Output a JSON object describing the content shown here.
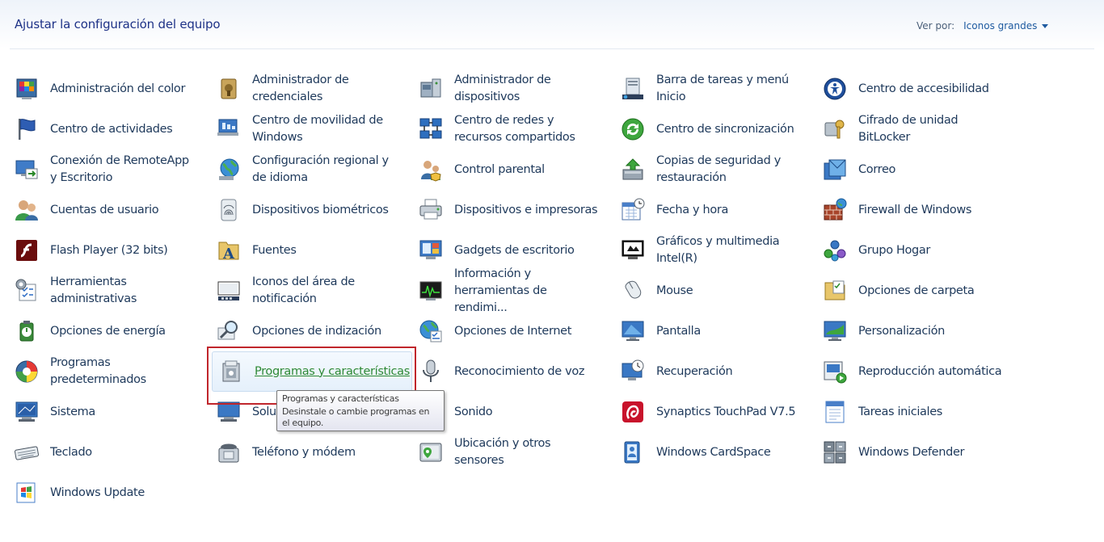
{
  "header": {
    "title": "Ajustar la configuración del equipo",
    "view_by_label": "Ver por:",
    "view_by_value": "Iconos grandes"
  },
  "items": [
    {
      "label": "Administración del color",
      "icon": "color-management-icon"
    },
    {
      "label": "Administrador de credenciales",
      "icon": "credential-manager-icon"
    },
    {
      "label": "Administrador de dispositivos",
      "icon": "device-manager-icon"
    },
    {
      "label": "Barra de tareas y menú Inicio",
      "icon": "taskbar-start-menu-icon"
    },
    {
      "label": "Centro de accesibilidad",
      "icon": "ease-of-access-icon"
    },
    {
      "label": "Centro de actividades",
      "icon": "action-center-flag-icon"
    },
    {
      "label": "Centro de movilidad de Windows",
      "icon": "mobility-center-icon"
    },
    {
      "label": "Centro de redes y recursos compartidos",
      "icon": "network-center-icon"
    },
    {
      "label": "Centro de sincronización",
      "icon": "sync-center-icon"
    },
    {
      "label": "Cifrado de unidad BitLocker",
      "icon": "bitlocker-key-icon"
    },
    {
      "label": "Conexión de RemoteApp y Escritorio",
      "icon": "remoteapp-icon"
    },
    {
      "label": "Configuración regional y de idioma",
      "icon": "region-language-globe-icon"
    },
    {
      "label": "Control parental",
      "icon": "parental-controls-icon"
    },
    {
      "label": "Copias de seguridad y restauración",
      "icon": "backup-restore-icon"
    },
    {
      "label": "Correo",
      "icon": "mail-icon"
    },
    {
      "label": "Cuentas de usuario",
      "icon": "user-accounts-icon"
    },
    {
      "label": "Dispositivos biométricos",
      "icon": "fingerprint-icon"
    },
    {
      "label": "Dispositivos e impresoras",
      "icon": "printer-icon"
    },
    {
      "label": "Fecha y hora",
      "icon": "calendar-clock-icon"
    },
    {
      "label": "Firewall de Windows",
      "icon": "firewall-icon"
    },
    {
      "label": "Flash Player (32 bits)",
      "icon": "flash-player-icon"
    },
    {
      "label": "Fuentes",
      "icon": "fonts-folder-icon"
    },
    {
      "label": "Gadgets de escritorio",
      "icon": "gadgets-icon"
    },
    {
      "label": "Gráficos y multimedia Intel(R)",
      "icon": "intel-graphics-icon"
    },
    {
      "label": "Grupo Hogar",
      "icon": "homegroup-icon"
    },
    {
      "label": "Herramientas administrativas",
      "icon": "admin-tools-icon"
    },
    {
      "label": "Iconos del área de notificación",
      "icon": "notification-area-icon"
    },
    {
      "label": "Información y herramientas de rendimi...",
      "icon": "performance-icon"
    },
    {
      "label": "Mouse",
      "icon": "mouse-icon"
    },
    {
      "label": "Opciones de carpeta",
      "icon": "folder-options-icon"
    },
    {
      "label": "Opciones de energía",
      "icon": "power-options-icon"
    },
    {
      "label": "Opciones de indización",
      "icon": "indexing-magnifier-icon"
    },
    {
      "label": "Opciones de Internet",
      "icon": "internet-options-icon"
    },
    {
      "label": "Pantalla",
      "icon": "display-monitor-icon"
    },
    {
      "label": "Personalización",
      "icon": "personalization-icon"
    },
    {
      "label": "Programas predeterminados",
      "icon": "default-programs-icon"
    },
    {
      "label": "Programas y características",
      "icon": "programs-features-icon"
    },
    {
      "label": "Reconocimiento de voz",
      "icon": "microphone-icon"
    },
    {
      "label": "Recuperación",
      "icon": "recovery-icon"
    },
    {
      "label": "Reproducción automática",
      "icon": "autoplay-icon"
    },
    {
      "label": "Sistema",
      "icon": "system-icon"
    },
    {
      "label": "Solu",
      "icon": "troubleshooting-icon"
    },
    {
      "label": "Sonido",
      "icon": "sound-icon"
    },
    {
      "label": "Synaptics TouchPad V7.5",
      "icon": "synaptics-icon"
    },
    {
      "label": "Tareas iniciales",
      "icon": "getting-started-icon"
    },
    {
      "label": "Teclado",
      "icon": "keyboard-icon"
    },
    {
      "label": "Teléfono y módem",
      "icon": "phone-modem-icon"
    },
    {
      "label": "Ubicación y otros sensores",
      "icon": "location-sensors-icon"
    },
    {
      "label": "Windows CardSpace",
      "icon": "cardspace-icon"
    },
    {
      "label": "Windows Defender",
      "icon": "windows-defender-icon"
    },
    {
      "label": "Windows Update",
      "icon": "windows-update-icon"
    }
  ],
  "tooltip": {
    "title": "Programas y características",
    "description": "Desinstale o cambie programas en el equipo."
  },
  "colors": {
    "link_text": "#1e395b",
    "title_text": "#1e3287",
    "hover_text": "#2f8a35",
    "highlight_border": "#c0262c"
  }
}
